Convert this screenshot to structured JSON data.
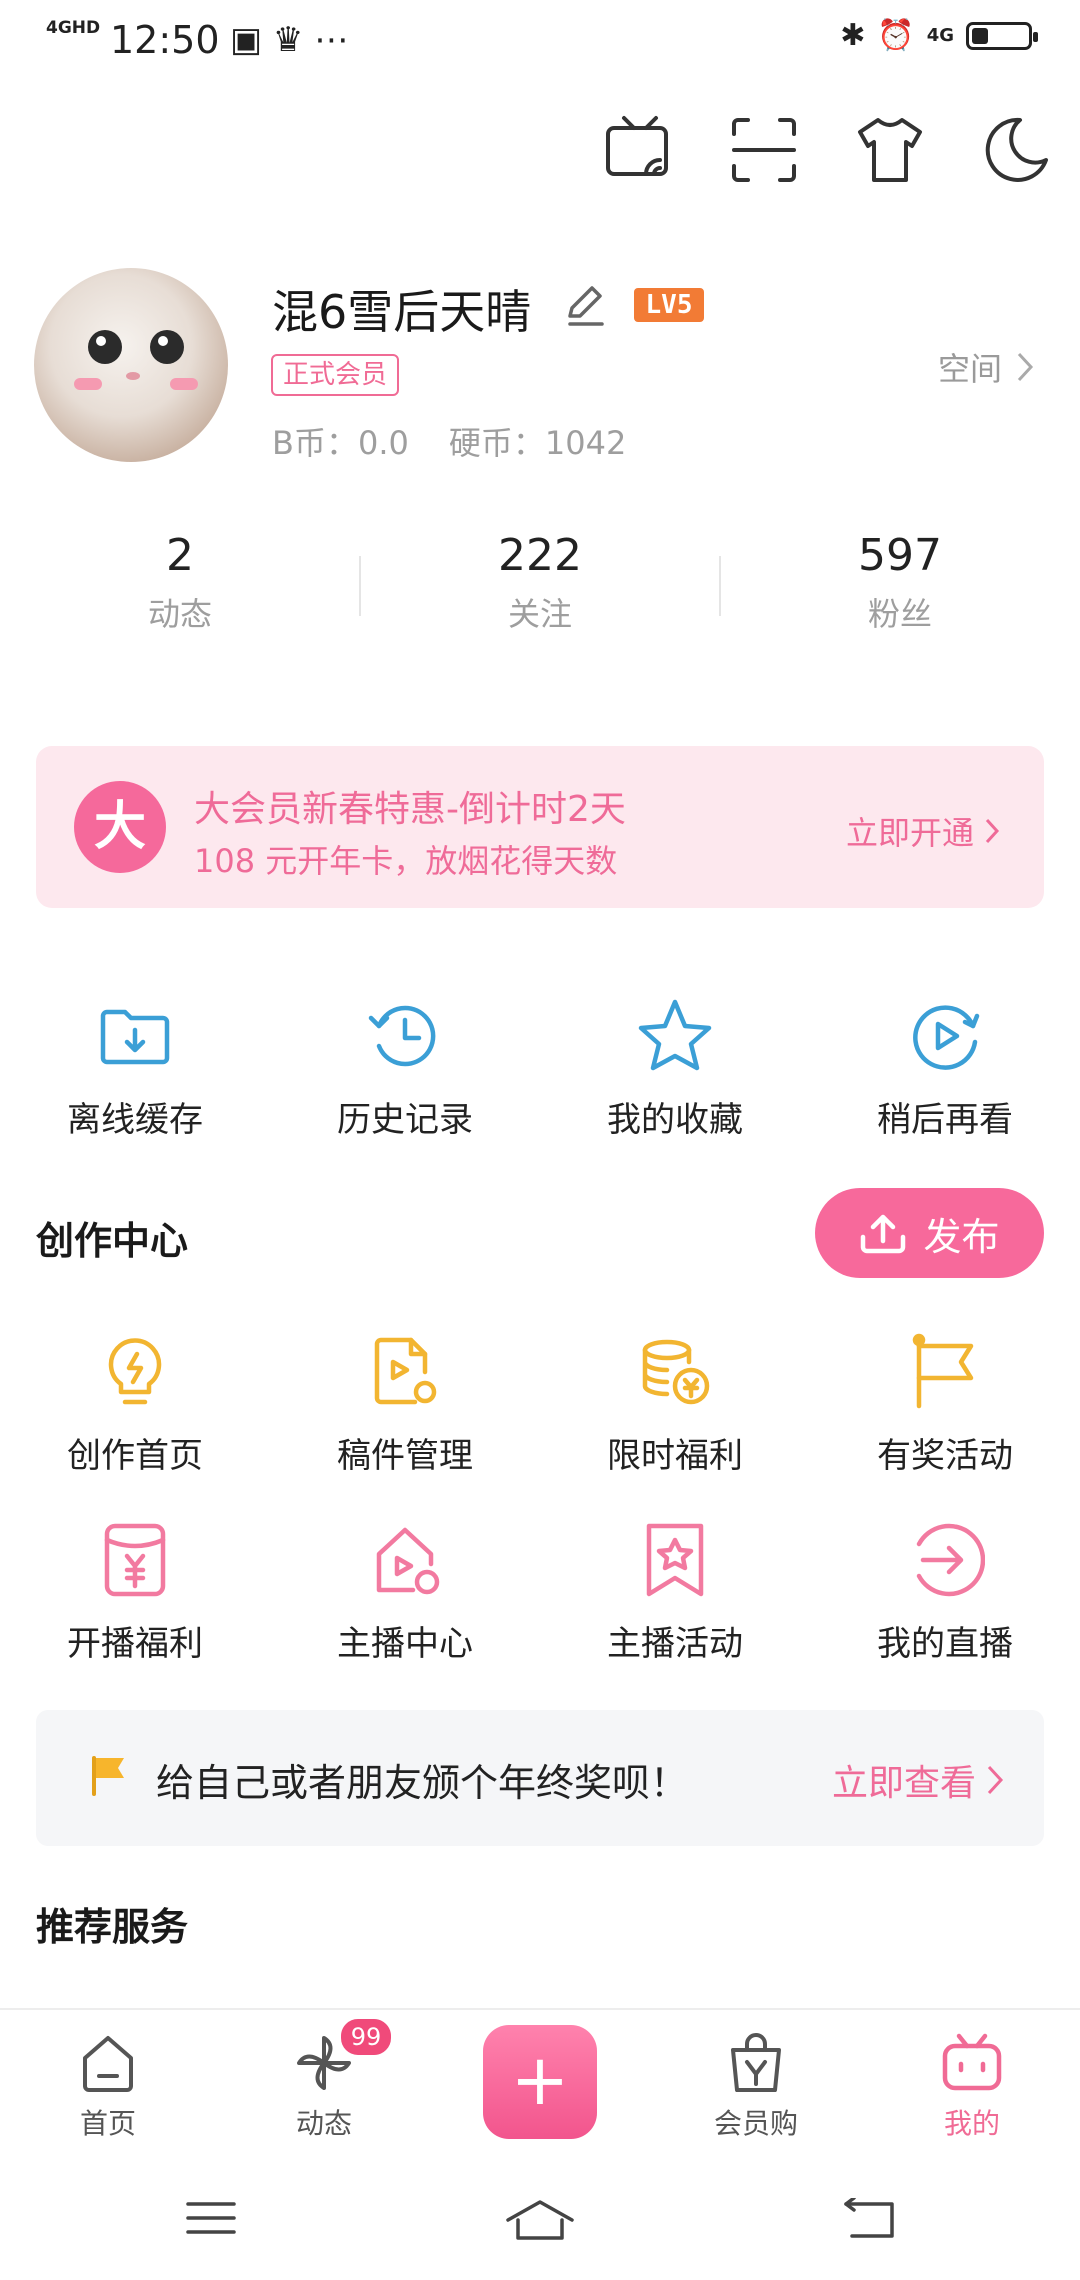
{
  "status_bar": {
    "time": "12:50",
    "network": "4GHD",
    "network2": "4G"
  },
  "profile": {
    "nickname": "混6雪后天晴",
    "level_badge": "LV5",
    "member_badge": "正式会员",
    "bcoin": "B币：0.0",
    "coins": "硬币：1042",
    "space_link": "空间"
  },
  "stats": [
    {
      "value": "2",
      "label": "动态"
    },
    {
      "value": "222",
      "label": "关注"
    },
    {
      "value": "597",
      "label": "粉丝"
    }
  ],
  "vip_banner": {
    "logo": "大",
    "title": "大会员新春特惠-倒计时2天",
    "subtitle": "108 元开年卡，放烟花得天数",
    "cta": "立即开通"
  },
  "quick_links": [
    {
      "label": "离线缓存",
      "icon": "download-folder-icon"
    },
    {
      "label": "历史记录",
      "icon": "history-clock-icon"
    },
    {
      "label": "我的收藏",
      "icon": "star-icon"
    },
    {
      "label": "稍后再看",
      "icon": "watch-later-icon"
    }
  ],
  "creation_center": {
    "title": "创作中心",
    "publish_label": "发布",
    "items": [
      {
        "label": "创作首页",
        "icon": "lightbulb-icon"
      },
      {
        "label": "稿件管理",
        "icon": "manuscript-icon"
      },
      {
        "label": "限时福利",
        "icon": "coins-icon"
      },
      {
        "label": "有奖活动",
        "icon": "flag-icon"
      },
      {
        "label": "开播福利",
        "icon": "red-envelope-icon"
      },
      {
        "label": "主播中心",
        "icon": "streamer-home-icon"
      },
      {
        "label": "主播活动",
        "icon": "bookmark-star-icon"
      },
      {
        "label": "我的直播",
        "icon": "live-enter-icon"
      }
    ]
  },
  "notice": {
    "text": "给自己或者朋友颁个年终奖呗！",
    "cta": "立即查看"
  },
  "recommend_title": "推荐服务",
  "tabbar": {
    "items": [
      {
        "label": "首页",
        "icon": "home-icon"
      },
      {
        "label": "动态",
        "icon": "pinwheel-icon",
        "badge": "99"
      },
      {
        "label": "",
        "icon": "plus-icon"
      },
      {
        "label": "会员购",
        "icon": "shopping-bag-icon"
      },
      {
        "label": "我的",
        "icon": "tv-mascot-icon"
      }
    ]
  },
  "colors": {
    "accent": "#f06b95",
    "vip_bg": "#fde8ee",
    "creation_icon": "#f2b531",
    "quick_icon": "#3b9fd6"
  }
}
